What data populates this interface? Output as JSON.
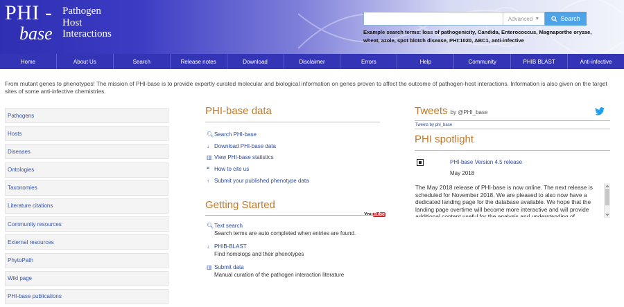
{
  "header": {
    "logo_phi": "PHI -",
    "logo_base": "base",
    "logo_sub": [
      "Pathogen",
      "Host",
      "Interactions"
    ],
    "search": {
      "value": "",
      "placeholder": "",
      "advanced_label": "Advanced",
      "search_label": "Search"
    },
    "examples": "Example search terms: loss of pathogenicity, Candida, Enterococcus, Magnaporthe oryzae, wheat, azole, spot blotch disease, PHI:1020, ABC1, anti-infective"
  },
  "nav": [
    "Home",
    "About Us",
    "Search",
    "Release notes",
    "Download",
    "Disclaimer",
    "Errors",
    "Help",
    "Community",
    "PHIB BLAST",
    "Anti-infective"
  ],
  "intro": "From mutant genes to phenotypes! The mission of PHI-base is to provide expertly curated molecular and biological information on genes proven to affect the outcome of pathogen-host interactions. Information is also given on the target sites of some anti-infective chemistries.",
  "sidebar": [
    "Pathogens",
    "Hosts",
    "Diseases",
    "Ontologies",
    "Taxonomies",
    "Literature citations",
    "Community resources",
    "External resources",
    "PhytoPath",
    "Wiki page",
    "PHI-base publications"
  ],
  "data_section": {
    "title": "PHI-base data",
    "links": [
      {
        "icon": "search-icon",
        "label": "Search PHI-base"
      },
      {
        "icon": "download-icon",
        "label": "Download PHI-base data"
      },
      {
        "icon": "bar-chart-icon",
        "label": "View PHI-base statistics"
      },
      {
        "icon": "quote-icon",
        "label": "How to cite us"
      },
      {
        "icon": "upload-icon",
        "label": "Submit your published phenotype data"
      }
    ]
  },
  "getting_started": {
    "title": "Getting Started",
    "youtube_you": "You",
    "youtube_tube": "Tube",
    "items": [
      {
        "icon": "search-icon",
        "label": "Text search",
        "desc": "Search terms are auto completed when entries are found."
      },
      {
        "icon": "download-icon",
        "label": "PHIB-BLAST",
        "desc": "Find homologs and their phenotypes"
      },
      {
        "icon": "bar-chart-icon",
        "label": "Submit data",
        "desc": "Manual curation of the pathogen interaction literature"
      }
    ]
  },
  "tweets": {
    "title": "Tweets",
    "handle": "by @PHI_base",
    "sub": "Tweets by phi_base"
  },
  "spotlight": {
    "title": "PHI spotlight",
    "link": "PHI-base Version 4.5 release",
    "date": "May 2018",
    "body": "The May 2018 release of PHI-base is now online. The next release is scheduled for November 2018. We are pleased to also now have a dedicated landing page for the database available. We hope that the landing page overtime will become more interactive and will provide additional content useful for the analysis and understanding of"
  },
  "colors": {
    "header_dark": "#2f2fb3",
    "nav": "#3434b6",
    "accent": "#c0782a",
    "link": "#2b4a9e",
    "search_btn": "#4da3e6"
  }
}
